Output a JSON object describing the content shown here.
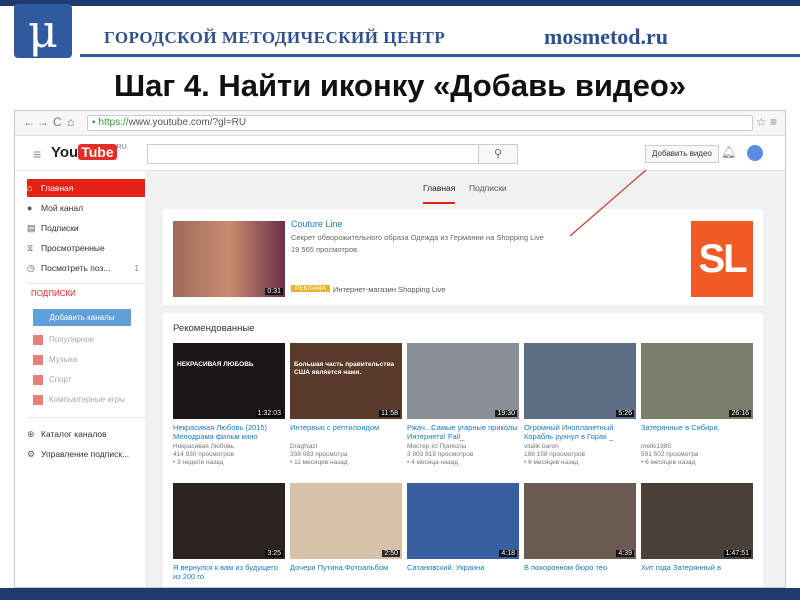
{
  "slide": {
    "org_title": "ГОРОДСКОЙ МЕТОДИЧЕСКИЙ ЦЕНТР",
    "site_name": "mosmetod.ru",
    "logo_glyph": "μ",
    "title": "Шаг 4. Найти иконку «Добавь видео»"
  },
  "browser": {
    "url_https": "https://",
    "url_rest": "www.youtube.com/?gl=RU",
    "nav_back": "←",
    "nav_forward": "→",
    "nav_reload": "C",
    "nav_home": "⌂",
    "right_icons": "☆ ≡"
  },
  "youtube": {
    "logo_you": "You",
    "logo_tube": "Tube",
    "logo_region": "RU",
    "search_placeholder": "",
    "upload_label": "Добавить видео",
    "sidebar": {
      "items": [
        {
          "label": "Главная",
          "icon": "⌂"
        },
        {
          "label": "Мой канал",
          "icon": "●"
        },
        {
          "label": "Подписки",
          "icon": "▤"
        },
        {
          "label": "Просмотренные",
          "icon": "⧖"
        },
        {
          "label": "Посмотреть поз...",
          "icon": "◷",
          "count": "1"
        }
      ],
      "subs_heading": "ПОДПИСКИ",
      "subs_button": "Добавить каналы",
      "categories": [
        "Популярное",
        "Музыка",
        "Спорт",
        "Компьютерные игры"
      ],
      "bottom_items": [
        {
          "label": "Каталог каналов",
          "icon": "⊕"
        },
        {
          "label": "Управление подписк...",
          "icon": "⚙"
        }
      ]
    },
    "tabs": [
      "Главная",
      "Подписки"
    ],
    "ad": {
      "title": "Couture Line",
      "desc": "Секрет обворожительного образа Одежда из Германии на Shopping Live",
      "views": "19 565 просмотров",
      "badge": "РЕКЛАМА",
      "text": "Интернет-магазин Shopping Live",
      "duration": "0:31",
      "logo": "SL"
    },
    "recommended_title": "Рекомендованные",
    "videos": [
      {
        "title": "Некрасивая Любовь (2015) Мелодрама фильм кино",
        "channel": "Некрасивая Любовь",
        "views": "414 930 просмотров",
        "ago": "3 недели назад",
        "duration": "1:32:03",
        "overlay": "НЕКРАСИВАЯ ЛЮБОВЬ",
        "color": "#1c1515"
      },
      {
        "title": "Интервью с рептилоидом",
        "channel": "DragNazi",
        "views": "338 083 просмотра",
        "ago": "11 месяцев назад",
        "duration": "11:58",
        "overlay": "Большая часть правительства США является нами.",
        "color": "#5a3a2a"
      },
      {
        "title": "Ржач...Самые угарные приколы Интернета! Fail_",
        "channel": "Мистер Icl Приколы",
        "views": "3 803 819 просмотров",
        "ago": "4 месяца назад",
        "duration": "19:30",
        "overlay": "",
        "color": "#8a8f98"
      },
      {
        "title": "Огромный Инопланетный Корабль рухнул в Горах _",
        "channel": "vitalik baron",
        "views": "186 158 просмотров",
        "ago": "6 месяцев назад",
        "duration": "5:26",
        "overlay": "",
        "color": "#5d6f85"
      },
      {
        "title": "Затерянные в Сибири.",
        "channel": "metki1985",
        "views": "591 502 просмотра",
        "ago": "6 месяцев назад",
        "duration": "26:16",
        "overlay": "",
        "color": "#7a7d6a"
      },
      {
        "title": "Я вернулся к вам из будущего из 200 го",
        "channel": "",
        "views": "",
        "ago": "",
        "duration": "3:25",
        "overlay": "",
        "color": "#2a2320"
      },
      {
        "title": "Дочери Путина.Фотоальбом",
        "channel": "",
        "views": "",
        "ago": "",
        "duration": "2:50",
        "overlay": "",
        "color": "#d6c2a8"
      },
      {
        "title": "Сатановский. Украина",
        "channel": "",
        "views": "",
        "ago": "",
        "duration": "4:18",
        "overlay": "",
        "color": "#3a5fa0"
      },
      {
        "title": "В похоронном бюро тео",
        "channel": "",
        "views": "",
        "ago": "",
        "duration": "4:39",
        "overlay": "",
        "color": "#6a5a50"
      },
      {
        "title": "Хит года Затерянный в",
        "channel": "",
        "views": "",
        "ago": "",
        "duration": "1:47:51",
        "overlay": "",
        "color": "#4a4038"
      }
    ]
  }
}
